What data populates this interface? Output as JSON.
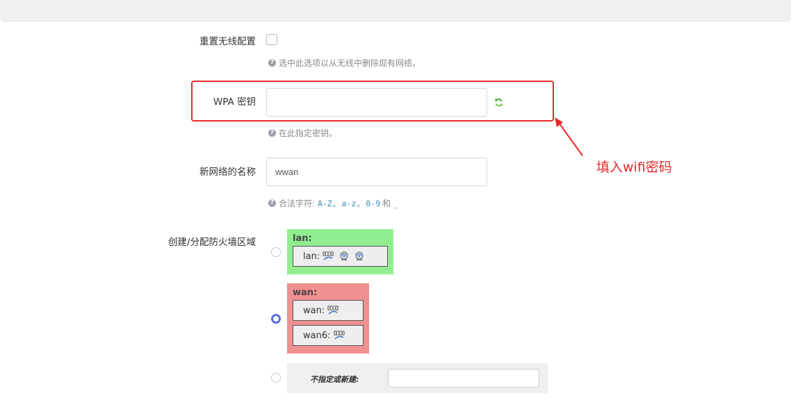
{
  "form": {
    "reset_wireless": {
      "label": "重置无线配置",
      "hint": "选中此选项以从无线中删除现有网络。"
    },
    "wpa_key": {
      "label": "WPA 密钥",
      "value": "",
      "hint": "在此指定密钥。"
    },
    "network_name": {
      "label": "新网络的名称",
      "value": "wwan",
      "hint_prefix": "合法字符:",
      "hint_chars": "A-Z, a-z, 0-9",
      "hint_and": "和",
      "hint_underscore": "_"
    },
    "firewall_zone": {
      "label": "创建/分配防火墙区域",
      "zones": [
        {
          "name": "lan:",
          "color": "#90ee90",
          "selected": false,
          "interfaces": [
            {
              "label": "lan:"
            }
          ]
        },
        {
          "name": "wan:",
          "color": "#f09090",
          "selected": true,
          "interfaces": [
            {
              "label": "wan:"
            },
            {
              "label": "wan6:"
            }
          ]
        }
      ],
      "unspecified_label": "不指定或新建:",
      "unspecified_value": ""
    }
  },
  "annotation": {
    "text": "填入wifi密码",
    "color": "#e8282b"
  },
  "colors": {
    "accent": "#5a6fd6",
    "highlight": "#e8282b"
  }
}
